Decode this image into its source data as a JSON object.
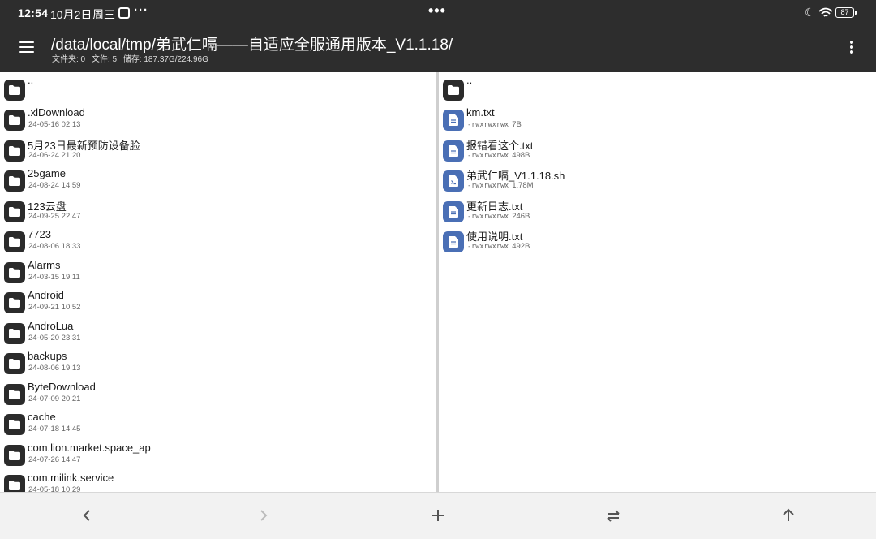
{
  "status_bar": {
    "time": "12:54",
    "date": "10月2日",
    "weekday": "周三",
    "dots_left": "···",
    "dots_center": "•••",
    "battery": "87",
    "icons": [
      "app-notification-icon",
      "moon-icon",
      "wifi-icon",
      "battery-icon"
    ]
  },
  "toolbar": {
    "menu_icon": "hamburger-menu-icon",
    "path": "/data/local/tmp/弟武仁嗝——自适应全服通用版本_V1.1.18/",
    "folders": "文件夹: 0",
    "files": "文件: 5",
    "storage": "储存: 187.37G/224.96G",
    "overflow_icon": "more-vert-icon"
  },
  "left_pane": {
    "up_item": {
      "name": "..",
      "icon": "folder-icon"
    },
    "items": [
      {
        "name": ".xlDownload",
        "date": "24-05-16 02:13",
        "icon": "folder-icon"
      },
      {
        "name": "5月23日最新预防设备脸",
        "date": "24-06-24 21:20",
        "icon": "folder-icon"
      },
      {
        "name": "25game",
        "date": "24-08-24 14:59",
        "icon": "folder-icon"
      },
      {
        "name": "123云盘",
        "date": "24-09-25 22:47",
        "icon": "folder-icon"
      },
      {
        "name": "7723",
        "date": "24-08-06 18:33",
        "icon": "folder-icon"
      },
      {
        "name": "Alarms",
        "date": "24-03-15 19:11",
        "icon": "folder-icon"
      },
      {
        "name": "Android",
        "date": "24-09-21 10:52",
        "icon": "folder-icon"
      },
      {
        "name": "AndroLua",
        "date": "24-05-20 23:31",
        "icon": "folder-icon"
      },
      {
        "name": "backups",
        "date": "24-08-06 19:13",
        "icon": "folder-icon"
      },
      {
        "name": "ByteDownload",
        "date": "24-07-09 20:21",
        "icon": "folder-icon"
      },
      {
        "name": "cache",
        "date": "24-07-18 14:45",
        "icon": "folder-icon"
      },
      {
        "name": "com.lion.market.space_ap",
        "date": "24-07-26 14:47",
        "icon": "folder-icon"
      },
      {
        "name": "com.milink.service",
        "date": "24-05-18 10:29",
        "icon": "folder-icon"
      }
    ]
  },
  "right_pane": {
    "up_item": {
      "name": "..",
      "icon": "folder-icon"
    },
    "items": [
      {
        "name": "km.txt",
        "perms": "-rwxrwxrwx",
        "size": "7B",
        "icon": "text-file-icon"
      },
      {
        "name": "报错看这个.txt",
        "perms": "-rwxrwxrwx",
        "size": "498B",
        "icon": "text-file-icon"
      },
      {
        "name": "弟武仁嗝_V1.1.18.sh",
        "perms": "-rwxrwxrwx",
        "size": "1.78M",
        "icon": "script-file-icon"
      },
      {
        "name": "更新日志.txt",
        "perms": "-rwxrwxrwx",
        "size": "246B",
        "icon": "text-file-icon"
      },
      {
        "name": "使用说明.txt",
        "perms": "-rwxrwxrwx",
        "size": "492B",
        "icon": "text-file-icon"
      }
    ]
  },
  "bottom_bar": {
    "buttons": [
      "back-icon",
      "forward-icon",
      "add-icon",
      "swap-icon",
      "up-icon"
    ]
  },
  "colors": {
    "toolbar_bg": "#2d2d2d",
    "folder_icon_bg": "#2b2b2b",
    "file_icon_bg": "#4a6fb5",
    "pane_bg": "#ffffff",
    "bottom_bg": "#f2f2f2"
  }
}
